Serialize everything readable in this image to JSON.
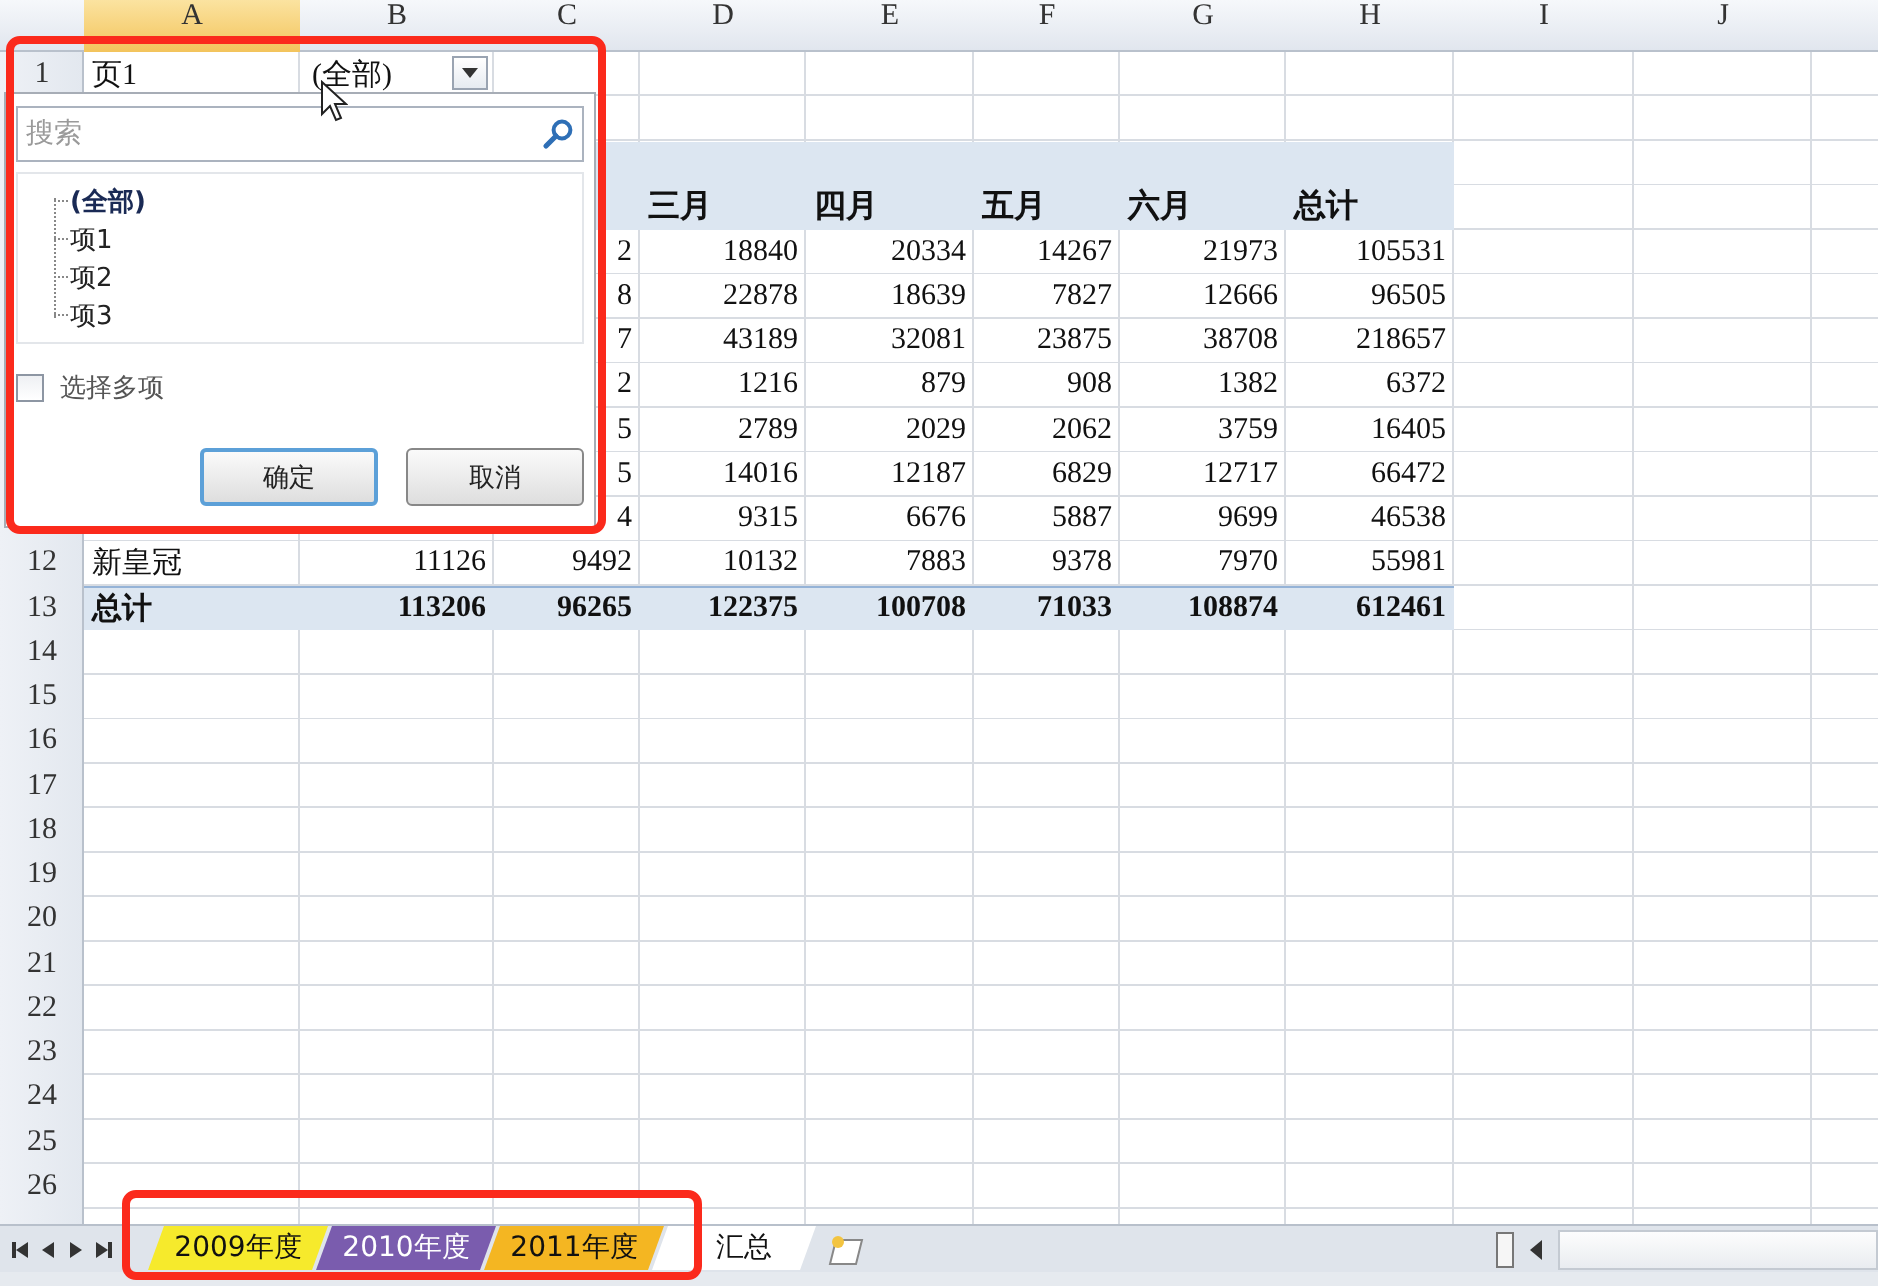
{
  "columns": [
    {
      "label": "A",
      "selected": true
    },
    {
      "label": "B",
      "selected": false
    },
    {
      "label": "C",
      "selected": false
    },
    {
      "label": "D",
      "selected": false
    },
    {
      "label": "E",
      "selected": false
    },
    {
      "label": "F",
      "selected": false
    },
    {
      "label": "G",
      "selected": false
    },
    {
      "label": "H",
      "selected": false
    },
    {
      "label": "I",
      "selected": false
    },
    {
      "label": "J",
      "selected": false
    }
  ],
  "rows": [
    {
      "number": "1",
      "kind": "filter",
      "cells": {
        "A": "页1",
        "B": "(全部)"
      }
    },
    {
      "kind": "plain"
    },
    {
      "kind": "header"
    },
    {
      "kind": "header",
      "cells": {
        "D": "三月",
        "E": "四月",
        "F": "五月",
        "G": "六月",
        "H": "总计"
      }
    },
    {
      "kind": "data",
      "cells": {
        "C": "2",
        "D": "18840",
        "E": "20334",
        "F": "14267",
        "G": "21973",
        "H": "105531"
      }
    },
    {
      "kind": "data",
      "cells": {
        "C": "8",
        "D": "22878",
        "E": "18639",
        "F": "7827",
        "G": "12666",
        "H": "96505"
      }
    },
    {
      "kind": "data",
      "cells": {
        "C": "7",
        "D": "43189",
        "E": "32081",
        "F": "23875",
        "G": "38708",
        "H": "218657"
      }
    },
    {
      "kind": "data",
      "cells": {
        "C": "2",
        "D": "1216",
        "E": "879",
        "F": "908",
        "G": "1382",
        "H": "6372"
      }
    },
    {
      "kind": "data",
      "cells": {
        "C": "5",
        "D": "2789",
        "E": "2029",
        "F": "2062",
        "G": "3759",
        "H": "16405"
      }
    },
    {
      "kind": "data",
      "cells": {
        "C": "5",
        "D": "14016",
        "E": "12187",
        "F": "6829",
        "G": "12717",
        "H": "66472"
      }
    },
    {
      "kind": "data",
      "cells": {
        "C": "4",
        "D": "9315",
        "E": "6676",
        "F": "5887",
        "G": "9699",
        "H": "46538"
      }
    },
    {
      "number": "12",
      "kind": "data",
      "cells": {
        "A": "新皇冠",
        "B": "11126",
        "C": "9492",
        "D": "10132",
        "E": "7883",
        "F": "9378",
        "G": "7970",
        "H": "55981"
      }
    },
    {
      "number": "13",
      "kind": "total",
      "cells": {
        "A": "总计",
        "B": "113206",
        "C": "96265",
        "D": "122375",
        "E": "100708",
        "F": "71033",
        "G": "108874",
        "H": "612461"
      }
    },
    {
      "number": "14",
      "kind": "plain"
    },
    {
      "number": "15",
      "kind": "plain"
    },
    {
      "number": "16",
      "kind": "plain"
    },
    {
      "number": "17",
      "kind": "plain"
    },
    {
      "number": "18",
      "kind": "plain"
    },
    {
      "number": "19",
      "kind": "plain"
    },
    {
      "number": "20",
      "kind": "plain"
    },
    {
      "number": "21",
      "kind": "plain"
    },
    {
      "number": "22",
      "kind": "plain"
    },
    {
      "number": "23",
      "kind": "plain"
    },
    {
      "number": "24",
      "kind": "plain"
    },
    {
      "number": "25",
      "kind": "plain"
    },
    {
      "number": "26",
      "kind": "plain"
    },
    {
      "kind": "plain"
    }
  ],
  "filter_dialog": {
    "search": {
      "placeholder": "搜索"
    },
    "items": [
      {
        "label": "(全部)",
        "selected": true
      },
      {
        "label": "项1",
        "selected": false
      },
      {
        "label": "项2",
        "selected": false
      },
      {
        "label": "项3",
        "selected": false
      }
    ],
    "multi_select": {
      "label": "选择多项",
      "checked": false
    },
    "buttons": [
      {
        "label": "确定",
        "default": true
      },
      {
        "label": "取消",
        "default": false
      }
    ]
  },
  "sheet_tabs": [
    {
      "label": "2009年度",
      "color": "#f6ea2c",
      "selected": false
    },
    {
      "label": "2010年度",
      "color": "#7a5cae",
      "selected": false
    },
    {
      "label": "2011年度",
      "color": "#f4b622",
      "selected": false
    },
    {
      "label": "汇总",
      "selected": true
    }
  ],
  "annotations": [
    {
      "kind": "frame"
    },
    {
      "kind": "frame"
    }
  ]
}
